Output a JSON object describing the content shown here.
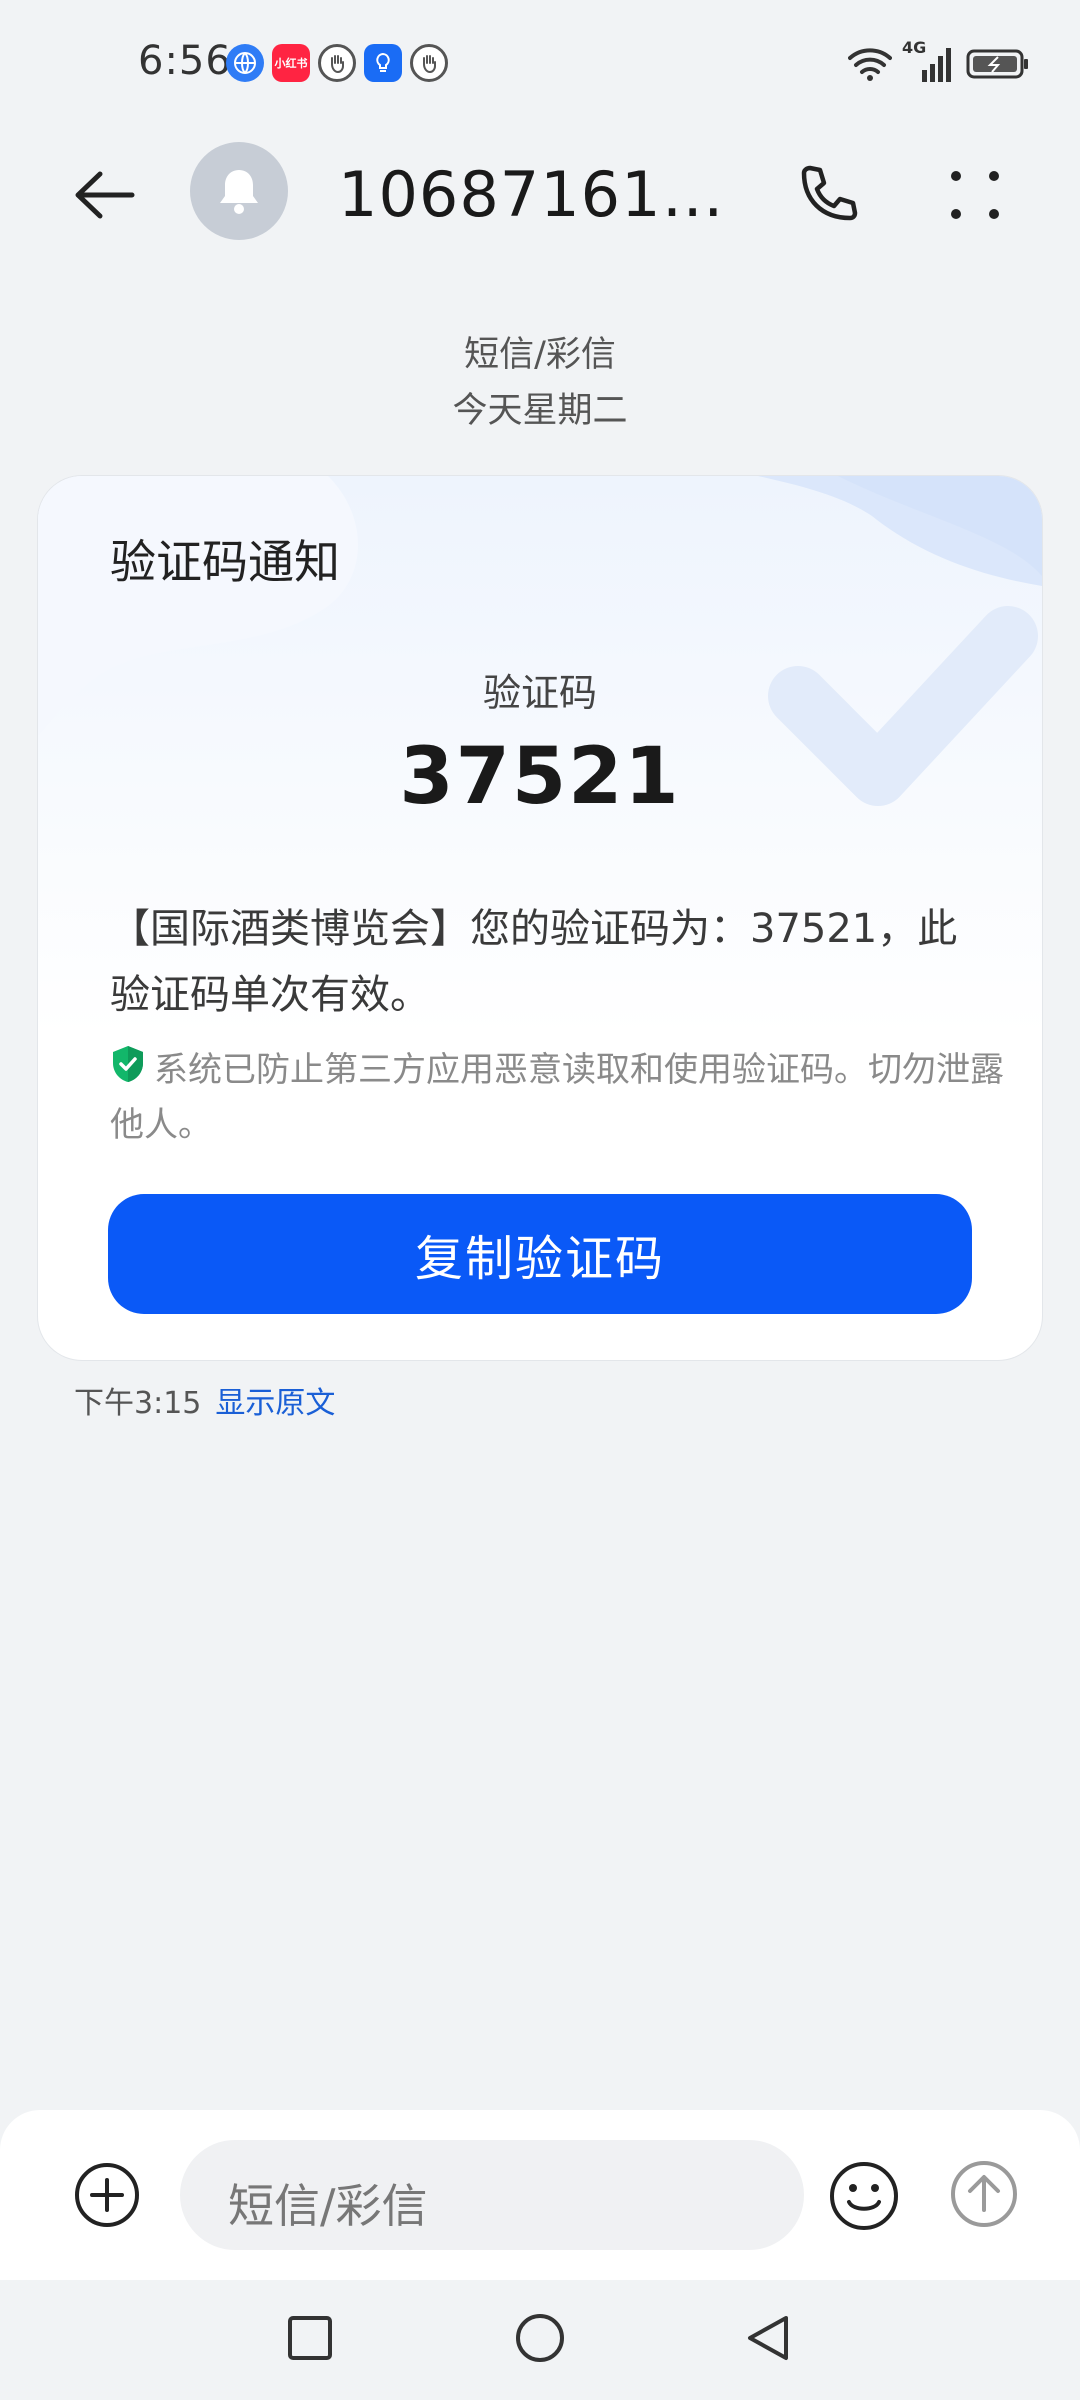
{
  "status_bar": {
    "time": "6:56",
    "app_icons": [
      "globe-icon",
      "xiaohongshu-icon",
      "hand-icon",
      "bulb-icon",
      "hand-icon"
    ],
    "xiaohongshu_label": "小红书",
    "network_label": "4G"
  },
  "header": {
    "title": "1068716110...",
    "avatar_icon": "bell-icon"
  },
  "conversation_meta": {
    "type": "短信/彩信",
    "date": "今天星期二"
  },
  "card": {
    "title": "验证码通知",
    "code_label": "验证码",
    "code_value": "37521",
    "message": "【国际酒类博览会】您的验证码为：37521，此验证码单次有效。",
    "security_note": "系统已防止第三方应用恶意读取和使用验证码。切勿泄露他人。",
    "copy_button": "复制验证码"
  },
  "message_meta": {
    "time": "下午3:15",
    "show_original": "显示原文"
  },
  "composer": {
    "placeholder": "短信/彩信"
  },
  "colors": {
    "accent": "#0a59f7",
    "link": "#1a5fd6",
    "shield": "#12b76a",
    "background": "#f1f3f5"
  }
}
